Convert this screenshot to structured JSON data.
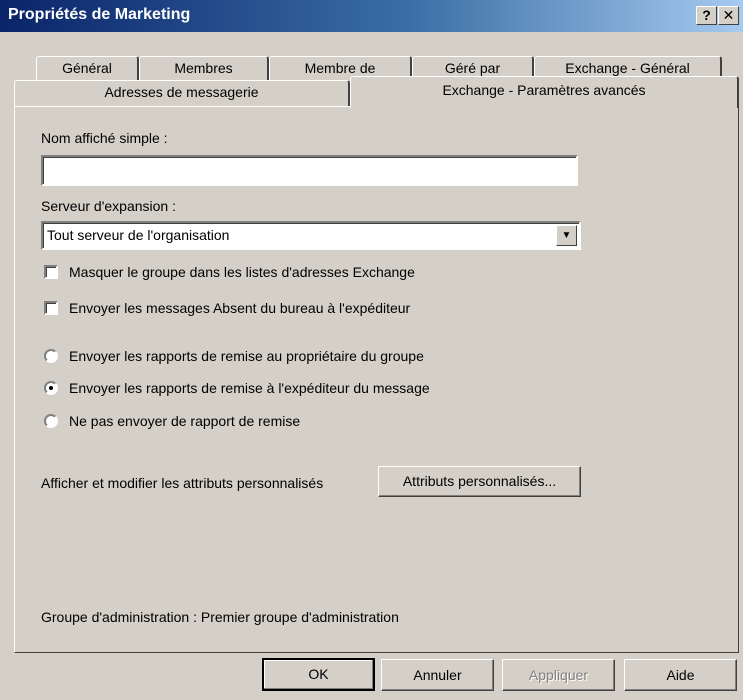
{
  "window": {
    "title": "Propriétés de Marketing",
    "help_glyph": "?",
    "close_glyph": "✕"
  },
  "tabs": {
    "row1": [
      "Général",
      "Membres",
      "Membre de",
      "Géré par",
      "Exchange - Général"
    ],
    "row2": [
      "Adresses de messagerie",
      "Exchange - Paramètres avancés"
    ],
    "active": "Exchange - Paramètres avancés"
  },
  "form": {
    "display_name_label": "Nom affiché simple :",
    "display_name_value": "",
    "expansion_label": "Serveur d'expansion :",
    "expansion_value": "Tout serveur de l'organisation",
    "hide_group_label": "Masquer le groupe dans les listes d'adresses Exchange",
    "hide_group_checked": false,
    "oof_label": "Envoyer les messages Absent du bureau à l'expéditeur",
    "oof_checked": false,
    "reports": [
      {
        "label": "Envoyer les rapports de remise au propriétaire du groupe",
        "selected": false
      },
      {
        "label": "Envoyer les rapports de remise à l'expéditeur du message",
        "selected": true
      },
      {
        "label": "Ne pas envoyer de rapport de remise",
        "selected": false
      }
    ],
    "custom_attrs_label": "Afficher et modifier les attributs personnalisés",
    "custom_attrs_button": "Attributs personnalisés...",
    "admin_group": "Groupe d'administration : Premier groupe d'administration"
  },
  "buttons": {
    "ok": "OK",
    "cancel": "Annuler",
    "apply": "Appliquer",
    "help": "Aide"
  },
  "icons": {
    "dropdown": "chevron-down-icon"
  }
}
